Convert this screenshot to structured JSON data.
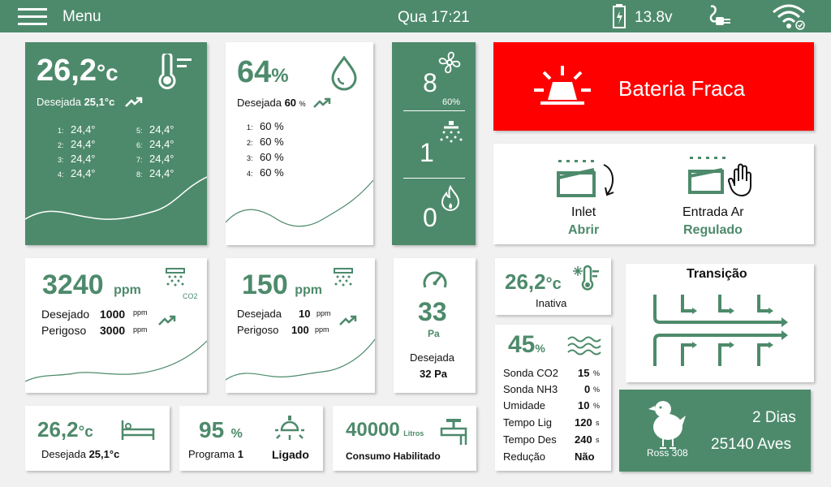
{
  "topbar": {
    "menu_label": "Menu",
    "datetime": "Qua 17:21",
    "battery_voltage": "13.8v"
  },
  "temperature": {
    "value": "26,2",
    "unit": "°c",
    "desired_label": "Desejada",
    "desired_value": "25,1°c",
    "sensors": [
      {
        "n": "1:",
        "v": "24,4°"
      },
      {
        "n": "2:",
        "v": "24,4°"
      },
      {
        "n": "3:",
        "v": "24,4°"
      },
      {
        "n": "4:",
        "v": "24,4°"
      },
      {
        "n": "5:",
        "v": "24,4°"
      },
      {
        "n": "6:",
        "v": "24,4°"
      },
      {
        "n": "7:",
        "v": "24,4°"
      },
      {
        "n": "8:",
        "v": "24,4°"
      }
    ]
  },
  "humidity": {
    "value": "64",
    "unit": "%",
    "desired_label": "Desejada",
    "desired_value": "60",
    "desired_unit": "%",
    "sensors": [
      {
        "n": "1:",
        "v": "60 %"
      },
      {
        "n": "2:",
        "v": "60 %"
      },
      {
        "n": "3:",
        "v": "60 %"
      },
      {
        "n": "4:",
        "v": "60 %"
      }
    ]
  },
  "equipment": {
    "fans": "8",
    "fans_percent": "60%",
    "nebulizers": "1",
    "heaters": "0"
  },
  "alarm": {
    "text": "Bateria Fraca",
    "color": "#ff0000"
  },
  "inlet": {
    "label": "Inlet",
    "status": "Abrir"
  },
  "air_entry": {
    "label": "Entrada Ar",
    "status": "Regulado"
  },
  "co2": {
    "value": "3240",
    "unit": "ppm",
    "icon_sub": "CO2",
    "desired_label": "Desejado",
    "desired_value": "1000",
    "danger_label": "Perigoso",
    "danger_value": "3000",
    "small_unit": "ppm"
  },
  "nh3": {
    "value": "150",
    "unit": "ppm",
    "desired_label": "Desejada",
    "desired_value": "10",
    "danger_label": "Perigoso",
    "danger_value": "100",
    "small_unit": "ppm"
  },
  "pressure": {
    "value": "33",
    "unit": "Pa",
    "desired_label": "Desejada",
    "desired_value": "32 Pa"
  },
  "outside_temp": {
    "value": "26,2",
    "unit": "°c",
    "status": "Inativa"
  },
  "transition": {
    "title": "Transição"
  },
  "ventilation": {
    "value": "45",
    "unit": "%",
    "rows": [
      {
        "label": "Sonda CO2",
        "value": "15",
        "unit": "%"
      },
      {
        "label": "Sonda NH3",
        "value": "0",
        "unit": "%"
      },
      {
        "label": "Umidade",
        "value": "10",
        "unit": "%"
      },
      {
        "label": "Tempo Lig",
        "value": "120",
        "unit": "s"
      },
      {
        "label": "Tempo Des",
        "value": "240",
        "unit": "s"
      },
      {
        "label": "Redução",
        "value": "Não",
        "unit": ""
      }
    ]
  },
  "flock": {
    "breed": "Ross 308",
    "days": "2 Dias",
    "birds": "25140 Aves"
  },
  "floor_temp": {
    "value": "26,2",
    "unit": "°c",
    "desired_label": "Desejada",
    "desired_value": "25,1°c"
  },
  "lighting": {
    "value": "95",
    "unit": "%",
    "program_label": "Programa",
    "program_value": "1",
    "status": "Ligado"
  },
  "water": {
    "value": "40000",
    "unit": "Litros",
    "label": "Consumo Habilitado"
  },
  "colors": {
    "primary": "#4d8a6b",
    "alarm": "#ff0000"
  }
}
